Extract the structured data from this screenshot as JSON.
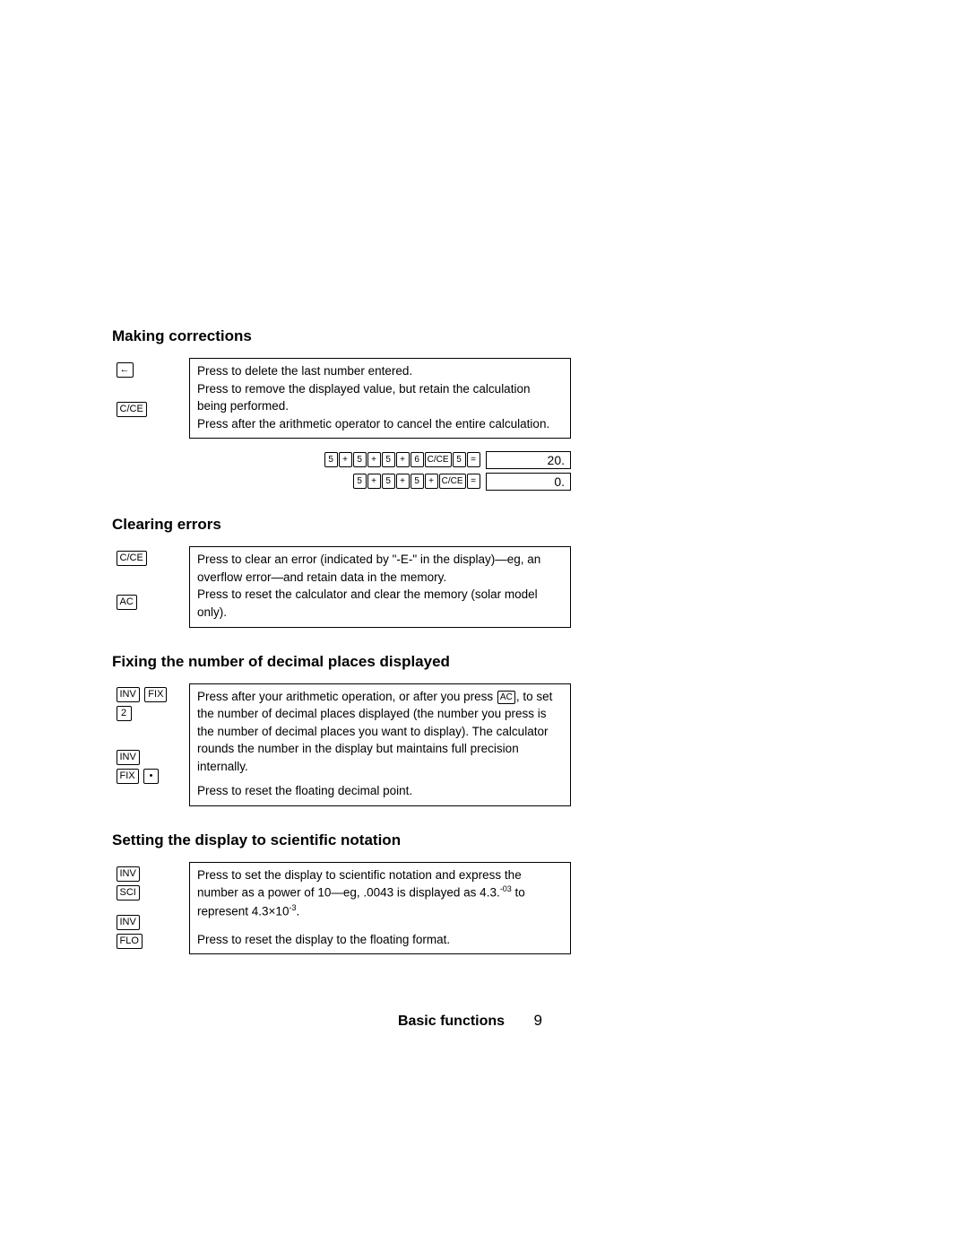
{
  "sections": {
    "making_corrections": {
      "heading": "Making corrections",
      "rows": [
        {
          "keys": [
            "←"
          ],
          "desc": "Press to delete the last number entered."
        },
        {
          "keys": [
            "C/CE"
          ],
          "desc_parts": [
            "Press to remove the displayed value, but retain the calculation being performed.",
            "Press after the arithmetic operator to cancel the entire calculation."
          ]
        }
      ],
      "examples": [
        {
          "keys": [
            "5",
            "+",
            "5",
            "+",
            "5",
            "+",
            "6",
            "C/CE",
            "5",
            "="
          ],
          "result": "20."
        },
        {
          "keys": [
            "5",
            "+",
            "5",
            "+",
            "5",
            "+",
            "C/CE",
            "="
          ],
          "result": "0."
        }
      ]
    },
    "clearing_errors": {
      "heading": "Clearing errors",
      "rows": [
        {
          "keys": [
            "C/CE"
          ],
          "desc": "Press to clear an error (indicated by \"-E-\" in the display)—eg, an overflow error—and retain data in the memory."
        },
        {
          "keys": [
            "AC"
          ],
          "desc": "Press to reset the calculator and clear the memory (solar model only)."
        }
      ]
    },
    "fixing_decimal": {
      "heading": "Fixing the number of decimal places displayed",
      "rows": [
        {
          "keys_lines": [
            [
              "INV",
              "FIX"
            ],
            [
              "2"
            ]
          ],
          "desc_pre": "Press after your arithmetic operation, or after you press ",
          "desc_key": "AC",
          "desc_post": ", to set the number of decimal places displayed (the number you press is the number of decimal places you want to display). The calculator rounds the number in the display but maintains full precision internally."
        },
        {
          "keys_lines": [
            [
              "INV"
            ],
            [
              "FIX",
              "•"
            ]
          ],
          "desc": "Press to reset the floating decimal point."
        }
      ]
    },
    "scientific_notation": {
      "heading": "Setting the display to scientific notation",
      "rows": [
        {
          "keys_lines": [
            [
              "INV"
            ],
            [
              "SCI"
            ]
          ],
          "desc_pre": "Press to set the display to scientific notation and express the number as a power of 10—eg, .0043 is displayed as 4.3.",
          "sup1": "-03",
          "desc_mid": " to represent 4.3×10",
          "sup2": "-3",
          "desc_post2": "."
        },
        {
          "keys_lines": [
            [
              "INV"
            ],
            [
              "FLO"
            ]
          ],
          "desc": "Press to reset the display to the floating format."
        }
      ]
    }
  },
  "footer": {
    "title": "Basic functions",
    "page": "9"
  }
}
